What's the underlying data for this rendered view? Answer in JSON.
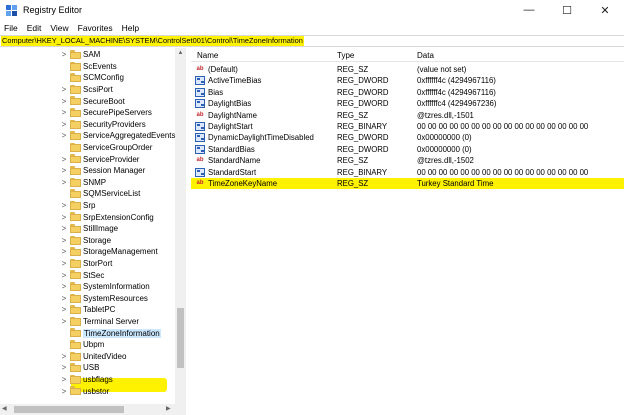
{
  "window": {
    "title": "Registry Editor",
    "controls": {
      "minimize": "—",
      "maximize": "☐",
      "close": "✕"
    }
  },
  "menu": [
    "File",
    "Edit",
    "View",
    "Favorites",
    "Help"
  ],
  "address": "Computer\\HKEY_LOCAL_MACHINE\\SYSTEM\\ControlSet001\\Control\\TimeZoneInformation",
  "tree": {
    "items": [
      {
        "label": "SAM",
        "expander": ">"
      },
      {
        "label": "ScEvents",
        "expander": ""
      },
      {
        "label": "SCMConfig",
        "expander": ""
      },
      {
        "label": "ScsiPort",
        "expander": ">"
      },
      {
        "label": "SecureBoot",
        "expander": ">"
      },
      {
        "label": "SecurePipeServers",
        "expander": ">"
      },
      {
        "label": "SecurityProviders",
        "expander": ">"
      },
      {
        "label": "ServiceAggregatedEvents",
        "expander": ">"
      },
      {
        "label": "ServiceGroupOrder",
        "expander": ""
      },
      {
        "label": "ServiceProvider",
        "expander": ">"
      },
      {
        "label": "Session Manager",
        "expander": ">"
      },
      {
        "label": "SNMP",
        "expander": ">"
      },
      {
        "label": "SQMServiceList",
        "expander": ""
      },
      {
        "label": "Srp",
        "expander": ">"
      },
      {
        "label": "SrpExtensionConfig",
        "expander": ">"
      },
      {
        "label": "StillImage",
        "expander": ">"
      },
      {
        "label": "Storage",
        "expander": ">"
      },
      {
        "label": "StorageManagement",
        "expander": ">"
      },
      {
        "label": "StorPort",
        "expander": ">"
      },
      {
        "label": "StSec",
        "expander": ">"
      },
      {
        "label": "SystemInformation",
        "expander": ">"
      },
      {
        "label": "SystemResources",
        "expander": ">"
      },
      {
        "label": "TabletPC",
        "expander": ">"
      },
      {
        "label": "Terminal Server",
        "expander": ">"
      },
      {
        "label": "TimeZoneInformation",
        "expander": ""
      },
      {
        "label": "Ubpm",
        "expander": ""
      },
      {
        "label": "UnitedVideo",
        "expander": ">"
      },
      {
        "label": "USB",
        "expander": ">"
      },
      {
        "label": "usbflags",
        "expander": ">"
      },
      {
        "label": "usbstor",
        "expander": ">"
      }
    ],
    "selected": "TimeZoneInformation"
  },
  "values": {
    "headers": {
      "name": "Name",
      "type": "Type",
      "data": "Data"
    },
    "rows": [
      {
        "icon": "string-value-icon",
        "kind": "sz",
        "name": "(Default)",
        "type": "REG_SZ",
        "data": "(value not set)"
      },
      {
        "icon": "binary-value-icon",
        "kind": "bin",
        "name": "ActiveTimeBias",
        "type": "REG_DWORD",
        "data": "0xffffff4c (4294967116)"
      },
      {
        "icon": "binary-value-icon",
        "kind": "bin",
        "name": "Bias",
        "type": "REG_DWORD",
        "data": "0xffffff4c (4294967116)"
      },
      {
        "icon": "binary-value-icon",
        "kind": "bin",
        "name": "DaylightBias",
        "type": "REG_DWORD",
        "data": "0xffffffc4 (4294967236)"
      },
      {
        "icon": "string-value-icon",
        "kind": "sz",
        "name": "DaylightName",
        "type": "REG_SZ",
        "data": "@tzres.dll,-1501"
      },
      {
        "icon": "binary-value-icon",
        "kind": "bin",
        "name": "DaylightStart",
        "type": "REG_BINARY",
        "data": "00 00 00 00 00 00 00 00 00 00 00 00 00 00 00 00"
      },
      {
        "icon": "binary-value-icon",
        "kind": "bin",
        "name": "DynamicDaylightTimeDisabled",
        "type": "REG_DWORD",
        "data": "0x00000000 (0)"
      },
      {
        "icon": "binary-value-icon",
        "kind": "bin",
        "name": "StandardBias",
        "type": "REG_DWORD",
        "data": "0x00000000 (0)"
      },
      {
        "icon": "string-value-icon",
        "kind": "sz",
        "name": "StandardName",
        "type": "REG_SZ",
        "data": "@tzres.dll,-1502"
      },
      {
        "icon": "binary-value-icon",
        "kind": "bin",
        "name": "StandardStart",
        "type": "REG_BINARY",
        "data": "00 00 00 00 00 00 00 00 00 00 00 00 00 00 00 00"
      },
      {
        "icon": "string-value-icon",
        "kind": "sz",
        "name": "TimeZoneKeyName",
        "type": "REG_SZ",
        "data": "Turkey Standard Time",
        "highlighted": true
      }
    ]
  },
  "colors": {
    "highlight": "#fff200",
    "selection": "#cce8ff",
    "folder": "#f4cf62",
    "string_icon": "#c0262d",
    "binary_icon": "#2d5fb3"
  }
}
